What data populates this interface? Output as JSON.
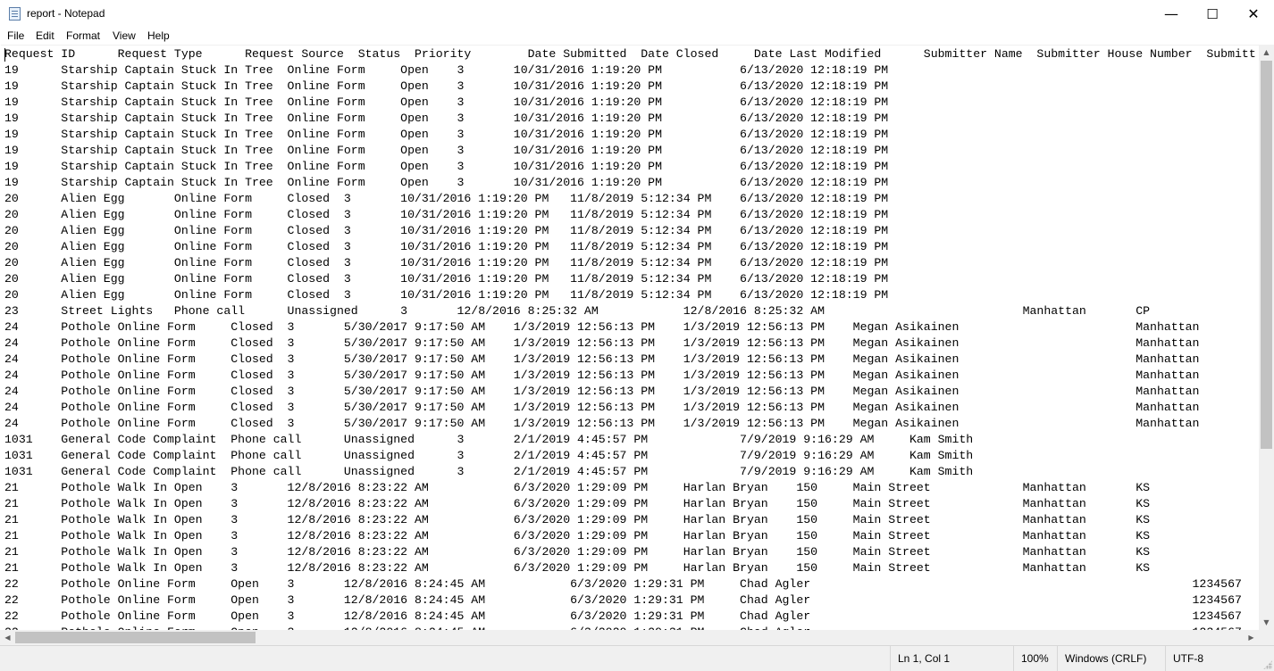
{
  "window": {
    "title": "report - Notepad",
    "icon": "notepad-icon",
    "buttons": {
      "minimize": "—",
      "maximize": "☐",
      "close": "✕"
    }
  },
  "menu": {
    "file": "File",
    "edit": "Edit",
    "format": "Format",
    "view": "View",
    "help": "Help"
  },
  "editor": {
    "lines": [
      "Request ID      Request Type      Request Source  Status  Priority        Date Submitted  Date Closed     Date Last Modified      Submitter Name  Submitter House Number  Submitt",
      "19      Starship Captain Stuck In Tree  Online Form     Open    3       10/31/2016 1:19:20 PM           6/13/2020 12:18:19 PM",
      "19      Starship Captain Stuck In Tree  Online Form     Open    3       10/31/2016 1:19:20 PM           6/13/2020 12:18:19 PM",
      "19      Starship Captain Stuck In Tree  Online Form     Open    3       10/31/2016 1:19:20 PM           6/13/2020 12:18:19 PM",
      "19      Starship Captain Stuck In Tree  Online Form     Open    3       10/31/2016 1:19:20 PM           6/13/2020 12:18:19 PM",
      "19      Starship Captain Stuck In Tree  Online Form     Open    3       10/31/2016 1:19:20 PM           6/13/2020 12:18:19 PM",
      "19      Starship Captain Stuck In Tree  Online Form     Open    3       10/31/2016 1:19:20 PM           6/13/2020 12:18:19 PM",
      "19      Starship Captain Stuck In Tree  Online Form     Open    3       10/31/2016 1:19:20 PM           6/13/2020 12:18:19 PM",
      "19      Starship Captain Stuck In Tree  Online Form     Open    3       10/31/2016 1:19:20 PM           6/13/2020 12:18:19 PM",
      "20      Alien Egg       Online Form     Closed  3       10/31/2016 1:19:20 PM   11/8/2019 5:12:34 PM    6/13/2020 12:18:19 PM",
      "20      Alien Egg       Online Form     Closed  3       10/31/2016 1:19:20 PM   11/8/2019 5:12:34 PM    6/13/2020 12:18:19 PM",
      "20      Alien Egg       Online Form     Closed  3       10/31/2016 1:19:20 PM   11/8/2019 5:12:34 PM    6/13/2020 12:18:19 PM",
      "20      Alien Egg       Online Form     Closed  3       10/31/2016 1:19:20 PM   11/8/2019 5:12:34 PM    6/13/2020 12:18:19 PM",
      "20      Alien Egg       Online Form     Closed  3       10/31/2016 1:19:20 PM   11/8/2019 5:12:34 PM    6/13/2020 12:18:19 PM",
      "20      Alien Egg       Online Form     Closed  3       10/31/2016 1:19:20 PM   11/8/2019 5:12:34 PM    6/13/2020 12:18:19 PM",
      "20      Alien Egg       Online Form     Closed  3       10/31/2016 1:19:20 PM   11/8/2019 5:12:34 PM    6/13/2020 12:18:19 PM",
      "23      Street Lights   Phone call      Unassigned      3       12/8/2016 8:25:32 AM            12/8/2016 8:25:32 AM                            Manhattan       CP",
      "24      Pothole Online Form     Closed  3       5/30/2017 9:17:50 AM    1/3/2019 12:56:13 PM    1/3/2019 12:56:13 PM    Megan Asikainen                         Manhattan",
      "24      Pothole Online Form     Closed  3       5/30/2017 9:17:50 AM    1/3/2019 12:56:13 PM    1/3/2019 12:56:13 PM    Megan Asikainen                         Manhattan",
      "24      Pothole Online Form     Closed  3       5/30/2017 9:17:50 AM    1/3/2019 12:56:13 PM    1/3/2019 12:56:13 PM    Megan Asikainen                         Manhattan",
      "24      Pothole Online Form     Closed  3       5/30/2017 9:17:50 AM    1/3/2019 12:56:13 PM    1/3/2019 12:56:13 PM    Megan Asikainen                         Manhattan",
      "24      Pothole Online Form     Closed  3       5/30/2017 9:17:50 AM    1/3/2019 12:56:13 PM    1/3/2019 12:56:13 PM    Megan Asikainen                         Manhattan",
      "24      Pothole Online Form     Closed  3       5/30/2017 9:17:50 AM    1/3/2019 12:56:13 PM    1/3/2019 12:56:13 PM    Megan Asikainen                         Manhattan",
      "24      Pothole Online Form     Closed  3       5/30/2017 9:17:50 AM    1/3/2019 12:56:13 PM    1/3/2019 12:56:13 PM    Megan Asikainen                         Manhattan",
      "1031    General Code Complaint  Phone call      Unassigned      3       2/1/2019 4:45:57 PM             7/9/2019 9:16:29 AM     Kam Smith",
      "1031    General Code Complaint  Phone call      Unassigned      3       2/1/2019 4:45:57 PM             7/9/2019 9:16:29 AM     Kam Smith",
      "1031    General Code Complaint  Phone call      Unassigned      3       2/1/2019 4:45:57 PM             7/9/2019 9:16:29 AM     Kam Smith",
      "21      Pothole Walk In Open    3       12/8/2016 8:23:22 AM            6/3/2020 1:29:09 PM     Harlan Bryan    150     Main Street             Manhattan       KS",
      "21      Pothole Walk In Open    3       12/8/2016 8:23:22 AM            6/3/2020 1:29:09 PM     Harlan Bryan    150     Main Street             Manhattan       KS",
      "21      Pothole Walk In Open    3       12/8/2016 8:23:22 AM            6/3/2020 1:29:09 PM     Harlan Bryan    150     Main Street             Manhattan       KS",
      "21      Pothole Walk In Open    3       12/8/2016 8:23:22 AM            6/3/2020 1:29:09 PM     Harlan Bryan    150     Main Street             Manhattan       KS",
      "21      Pothole Walk In Open    3       12/8/2016 8:23:22 AM            6/3/2020 1:29:09 PM     Harlan Bryan    150     Main Street             Manhattan       KS",
      "21      Pothole Walk In Open    3       12/8/2016 8:23:22 AM            6/3/2020 1:29:09 PM     Harlan Bryan    150     Main Street             Manhattan       KS",
      "22      Pothole Online Form     Open    3       12/8/2016 8:24:45 AM            6/3/2020 1:29:31 PM     Chad Agler                                                      1234567",
      "22      Pothole Online Form     Open    3       12/8/2016 8:24:45 AM            6/3/2020 1:29:31 PM     Chad Agler                                                      1234567",
      "22      Pothole Online Form     Open    3       12/8/2016 8:24:45 AM            6/3/2020 1:29:31 PM     Chad Agler                                                      1234567",
      "22      Pothole Online Form     Open    3       12/8/2016 8:24:45 AM            6/3/2020 1:29:31 PM     Chad Agler                                                      1234567"
    ]
  },
  "scrollbars": {
    "up_arrow": "▲",
    "down_arrow": "▼",
    "left_arrow": "◀",
    "right_arrow": "▶"
  },
  "status": {
    "position": "Ln 1, Col 1",
    "zoom": "100%",
    "line_ending": "Windows (CRLF)",
    "encoding": "UTF-8"
  }
}
